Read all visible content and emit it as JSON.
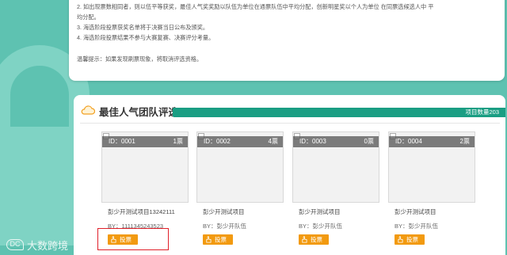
{
  "notice": {
    "line1": "2. 如出现票数相同者，则以伍平等获奖，最佳人气奖奖励以队伍为单位在通票队伍中平均分配，创新明星奖以个人为单位 在同票选候选人中 平",
    "line1b": "均分配。",
    "line2": "3. 海选阶段投票获奖名单将于决赛当日公布及颁奖。",
    "line3": "4. 海选阶段投票结果不参与大赛复赛、决赛评分考量。",
    "tip": "温馨提示：如果发现刷票现象，将取消评选资格。"
  },
  "section": {
    "title": "最佳人气团队评选",
    "count": "项目数量203"
  },
  "cards": [
    {
      "id": "ID：0001",
      "votes": "1票",
      "name": "彭少开测试项目13242111",
      "by": "BY：1111345243523",
      "vote_label": "投票"
    },
    {
      "id": "ID：0002",
      "votes": "4票",
      "name": "彭少开测试项目",
      "by": "BY：彭少开队伍",
      "vote_label": "投票"
    },
    {
      "id": "ID：0003",
      "votes": "0票",
      "name": "彭少开测试项目",
      "by": "BY：彭少开队伍",
      "vote_label": "投票"
    },
    {
      "id": "ID：0004",
      "votes": "2票",
      "name": "彭少开测试项目",
      "by": "BY：彭少开队伍",
      "vote_label": "投票"
    }
  ],
  "thumb_alt": "彭少开测试项目13242111",
  "logo": {
    "mark": "DC",
    "text": "大数跨境"
  },
  "colors": {
    "background": "#5ec2b1",
    "accent": "#1a9e83",
    "vote_button": "#f29a10",
    "highlight": "#e0202a"
  }
}
